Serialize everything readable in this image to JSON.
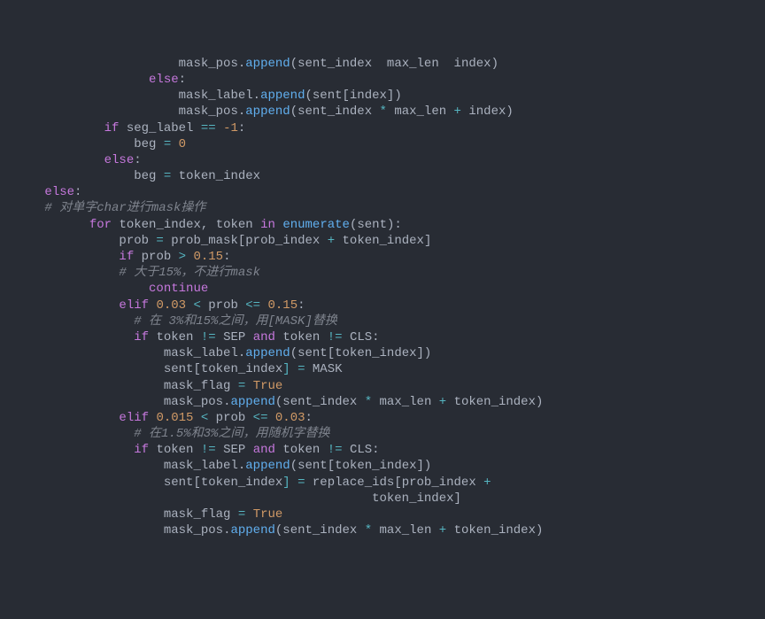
{
  "code": {
    "lines": [
      {
        "indent": 24,
        "segments": [
          {
            "text": "mask_pos",
            "cls": "var2"
          },
          {
            "text": ".",
            "cls": "punc"
          },
          {
            "text": "append",
            "cls": "fn"
          },
          {
            "text": "(",
            "cls": "punc"
          },
          {
            "text": "sent_index",
            "cls": "var2"
          },
          {
            "text": "  ",
            "cls": "punc"
          },
          {
            "text": "max_len",
            "cls": "var2"
          },
          {
            "text": "  ",
            "cls": "punc"
          },
          {
            "text": "index",
            "cls": "var2"
          },
          {
            "text": ")",
            "cls": "punc"
          }
        ],
        "truncated_top": true
      },
      {
        "indent": 20,
        "segments": [
          {
            "text": "else",
            "cls": "kw"
          },
          {
            "text": ":",
            "cls": "punc"
          }
        ]
      },
      {
        "indent": 24,
        "segments": [
          {
            "text": "mask_label",
            "cls": "var2"
          },
          {
            "text": ".",
            "cls": "punc"
          },
          {
            "text": "append",
            "cls": "fn"
          },
          {
            "text": "(",
            "cls": "punc"
          },
          {
            "text": "sent",
            "cls": "var2"
          },
          {
            "text": "[",
            "cls": "punc"
          },
          {
            "text": "index",
            "cls": "var2"
          },
          {
            "text": "])",
            "cls": "punc"
          }
        ]
      },
      {
        "indent": 24,
        "segments": [
          {
            "text": "mask_pos",
            "cls": "var2"
          },
          {
            "text": ".",
            "cls": "punc"
          },
          {
            "text": "append",
            "cls": "fn"
          },
          {
            "text": "(",
            "cls": "punc"
          },
          {
            "text": "sent_index",
            "cls": "var2"
          },
          {
            "text": " * ",
            "cls": "op"
          },
          {
            "text": "max_len",
            "cls": "var2"
          },
          {
            "text": " + ",
            "cls": "op"
          },
          {
            "text": "index",
            "cls": "var2"
          },
          {
            "text": ")",
            "cls": "punc"
          }
        ]
      },
      {
        "indent": 0,
        "segments": []
      },
      {
        "indent": 14,
        "segments": [
          {
            "text": "if",
            "cls": "kw"
          },
          {
            "text": " ",
            "cls": "punc"
          },
          {
            "text": "seg_label",
            "cls": "var2"
          },
          {
            "text": " == ",
            "cls": "op"
          },
          {
            "text": "-1",
            "cls": "num"
          },
          {
            "text": ":",
            "cls": "punc"
          }
        ]
      },
      {
        "indent": 18,
        "segments": [
          {
            "text": "beg",
            "cls": "var2"
          },
          {
            "text": " = ",
            "cls": "op"
          },
          {
            "text": "0",
            "cls": "num"
          }
        ]
      },
      {
        "indent": 14,
        "segments": [
          {
            "text": "else",
            "cls": "kw"
          },
          {
            "text": ":",
            "cls": "punc"
          }
        ]
      },
      {
        "indent": 18,
        "segments": [
          {
            "text": "beg",
            "cls": "var2"
          },
          {
            "text": " = ",
            "cls": "op"
          },
          {
            "text": "token_index",
            "cls": "var2"
          }
        ]
      },
      {
        "indent": 6,
        "segments": [
          {
            "text": "else",
            "cls": "kw"
          },
          {
            "text": ":",
            "cls": "punc"
          }
        ]
      },
      {
        "indent": 6,
        "segments": [
          {
            "text": "# 对单字char进行mask操作",
            "cls": "cmt"
          }
        ]
      },
      {
        "indent": 12,
        "segments": [
          {
            "text": "for",
            "cls": "kw"
          },
          {
            "text": " ",
            "cls": "punc"
          },
          {
            "text": "token_index",
            "cls": "var2"
          },
          {
            "text": ", ",
            "cls": "punc"
          },
          {
            "text": "token",
            "cls": "var2"
          },
          {
            "text": " ",
            "cls": "punc"
          },
          {
            "text": "in",
            "cls": "kw"
          },
          {
            "text": " ",
            "cls": "punc"
          },
          {
            "text": "enumerate",
            "cls": "fn"
          },
          {
            "text": "(",
            "cls": "punc"
          },
          {
            "text": "sent",
            "cls": "var2"
          },
          {
            "text": "):",
            "cls": "punc"
          }
        ]
      },
      {
        "indent": 16,
        "segments": [
          {
            "text": "prob",
            "cls": "var2"
          },
          {
            "text": " = ",
            "cls": "op"
          },
          {
            "text": "prob_mask",
            "cls": "var2"
          },
          {
            "text": "[",
            "cls": "punc"
          },
          {
            "text": "prob_index",
            "cls": "var2"
          },
          {
            "text": " + ",
            "cls": "op"
          },
          {
            "text": "token_index",
            "cls": "var2"
          },
          {
            "text": "]",
            "cls": "punc"
          }
        ]
      },
      {
        "indent": 16,
        "segments": [
          {
            "text": "if",
            "cls": "kw"
          },
          {
            "text": " ",
            "cls": "punc"
          },
          {
            "text": "prob",
            "cls": "var2"
          },
          {
            "text": " > ",
            "cls": "op"
          },
          {
            "text": "0.15",
            "cls": "num"
          },
          {
            "text": ":",
            "cls": "punc"
          }
        ]
      },
      {
        "indent": 16,
        "segments": [
          {
            "text": "# 大于15%，不进行mask",
            "cls": "cmt"
          }
        ]
      },
      {
        "indent": 20,
        "segments": [
          {
            "text": "continue",
            "cls": "kw"
          }
        ]
      },
      {
        "indent": 16,
        "segments": [
          {
            "text": "elif",
            "cls": "kw"
          },
          {
            "text": " ",
            "cls": "punc"
          },
          {
            "text": "0.03",
            "cls": "num"
          },
          {
            "text": " < ",
            "cls": "op"
          },
          {
            "text": "prob",
            "cls": "var2"
          },
          {
            "text": " <= ",
            "cls": "op"
          },
          {
            "text": "0.15",
            "cls": "num"
          },
          {
            "text": ":",
            "cls": "punc"
          }
        ]
      },
      {
        "indent": 18,
        "segments": [
          {
            "text": "# 在 3%和15%之间，用[MASK]替换",
            "cls": "cmt"
          }
        ]
      },
      {
        "indent": 18,
        "segments": [
          {
            "text": "if",
            "cls": "kw"
          },
          {
            "text": " ",
            "cls": "punc"
          },
          {
            "text": "token",
            "cls": "var2"
          },
          {
            "text": " != ",
            "cls": "op"
          },
          {
            "text": "SEP",
            "cls": "var2"
          },
          {
            "text": " ",
            "cls": "punc"
          },
          {
            "text": "and",
            "cls": "kw"
          },
          {
            "text": " ",
            "cls": "punc"
          },
          {
            "text": "token",
            "cls": "var2"
          },
          {
            "text": " != ",
            "cls": "op"
          },
          {
            "text": "CLS",
            "cls": "var2"
          },
          {
            "text": ":",
            "cls": "punc"
          }
        ]
      },
      {
        "indent": 22,
        "segments": [
          {
            "text": "mask_label",
            "cls": "var2"
          },
          {
            "text": ".",
            "cls": "punc"
          },
          {
            "text": "append",
            "cls": "fn"
          },
          {
            "text": "(",
            "cls": "punc"
          },
          {
            "text": "sent",
            "cls": "var2"
          },
          {
            "text": "[",
            "cls": "punc"
          },
          {
            "text": "token_index",
            "cls": "var2"
          },
          {
            "text": "])",
            "cls": "punc"
          }
        ]
      },
      {
        "indent": 22,
        "segments": [
          {
            "text": "sent",
            "cls": "var2"
          },
          {
            "text": "[",
            "cls": "punc"
          },
          {
            "text": "token_index",
            "cls": "var2"
          },
          {
            "text": "] = ",
            "cls": "op"
          },
          {
            "text": "MASK",
            "cls": "var2"
          }
        ]
      },
      {
        "indent": 22,
        "segments": [
          {
            "text": "mask_flag",
            "cls": "var2"
          },
          {
            "text": " = ",
            "cls": "op"
          },
          {
            "text": "True",
            "cls": "const"
          }
        ]
      },
      {
        "indent": 22,
        "segments": [
          {
            "text": "mask_pos",
            "cls": "var2"
          },
          {
            "text": ".",
            "cls": "punc"
          },
          {
            "text": "append",
            "cls": "fn"
          },
          {
            "text": "(",
            "cls": "punc"
          },
          {
            "text": "sent_index",
            "cls": "var2"
          },
          {
            "text": " * ",
            "cls": "op"
          },
          {
            "text": "max_len",
            "cls": "var2"
          },
          {
            "text": " + ",
            "cls": "op"
          },
          {
            "text": "token_index",
            "cls": "var2"
          },
          {
            "text": ")",
            "cls": "punc"
          }
        ]
      },
      {
        "indent": 16,
        "segments": [
          {
            "text": "elif",
            "cls": "kw"
          },
          {
            "text": " ",
            "cls": "punc"
          },
          {
            "text": "0.015",
            "cls": "num"
          },
          {
            "text": " < ",
            "cls": "op"
          },
          {
            "text": "prob",
            "cls": "var2"
          },
          {
            "text": " <= ",
            "cls": "op"
          },
          {
            "text": "0.03",
            "cls": "num"
          },
          {
            "text": ":",
            "cls": "punc"
          }
        ]
      },
      {
        "indent": 18,
        "segments": [
          {
            "text": "# 在1.5%和3%之间，用随机字替换",
            "cls": "cmt"
          }
        ]
      },
      {
        "indent": 18,
        "segments": [
          {
            "text": "if",
            "cls": "kw"
          },
          {
            "text": " ",
            "cls": "punc"
          },
          {
            "text": "token",
            "cls": "var2"
          },
          {
            "text": " != ",
            "cls": "op"
          },
          {
            "text": "SEP",
            "cls": "var2"
          },
          {
            "text": " ",
            "cls": "punc"
          },
          {
            "text": "and",
            "cls": "kw"
          },
          {
            "text": " ",
            "cls": "punc"
          },
          {
            "text": "token",
            "cls": "var2"
          },
          {
            "text": " != ",
            "cls": "op"
          },
          {
            "text": "CLS",
            "cls": "var2"
          },
          {
            "text": ":",
            "cls": "punc"
          }
        ]
      },
      {
        "indent": 22,
        "segments": [
          {
            "text": "mask_label",
            "cls": "var2"
          },
          {
            "text": ".",
            "cls": "punc"
          },
          {
            "text": "append",
            "cls": "fn"
          },
          {
            "text": "(",
            "cls": "punc"
          },
          {
            "text": "sent",
            "cls": "var2"
          },
          {
            "text": "[",
            "cls": "punc"
          },
          {
            "text": "token_index",
            "cls": "var2"
          },
          {
            "text": "])",
            "cls": "punc"
          }
        ]
      },
      {
        "indent": 22,
        "segments": [
          {
            "text": "sent",
            "cls": "var2"
          },
          {
            "text": "[",
            "cls": "punc"
          },
          {
            "text": "token_index",
            "cls": "var2"
          },
          {
            "text": "] = ",
            "cls": "op"
          },
          {
            "text": "replace_ids",
            "cls": "var2"
          },
          {
            "text": "[",
            "cls": "punc"
          },
          {
            "text": "prob_index",
            "cls": "var2"
          },
          {
            "text": " +",
            "cls": "op"
          }
        ]
      },
      {
        "indent": 50,
        "segments": [
          {
            "text": "token_index",
            "cls": "var2"
          },
          {
            "text": "]",
            "cls": "punc"
          }
        ]
      },
      {
        "indent": 22,
        "segments": [
          {
            "text": "mask_flag",
            "cls": "var2"
          },
          {
            "text": " = ",
            "cls": "op"
          },
          {
            "text": "True",
            "cls": "const"
          }
        ]
      },
      {
        "indent": 22,
        "segments": [
          {
            "text": "mask_pos",
            "cls": "var2"
          },
          {
            "text": ".",
            "cls": "punc"
          },
          {
            "text": "append",
            "cls": "fn"
          },
          {
            "text": "(",
            "cls": "punc"
          },
          {
            "text": "sent_index",
            "cls": "var2"
          },
          {
            "text": " * ",
            "cls": "op"
          },
          {
            "text": "max_len",
            "cls": "var2"
          },
          {
            "text": " + ",
            "cls": "op"
          },
          {
            "text": "token_index",
            "cls": "var2"
          },
          {
            "text": ")",
            "cls": "punc"
          }
        ]
      }
    ]
  }
}
